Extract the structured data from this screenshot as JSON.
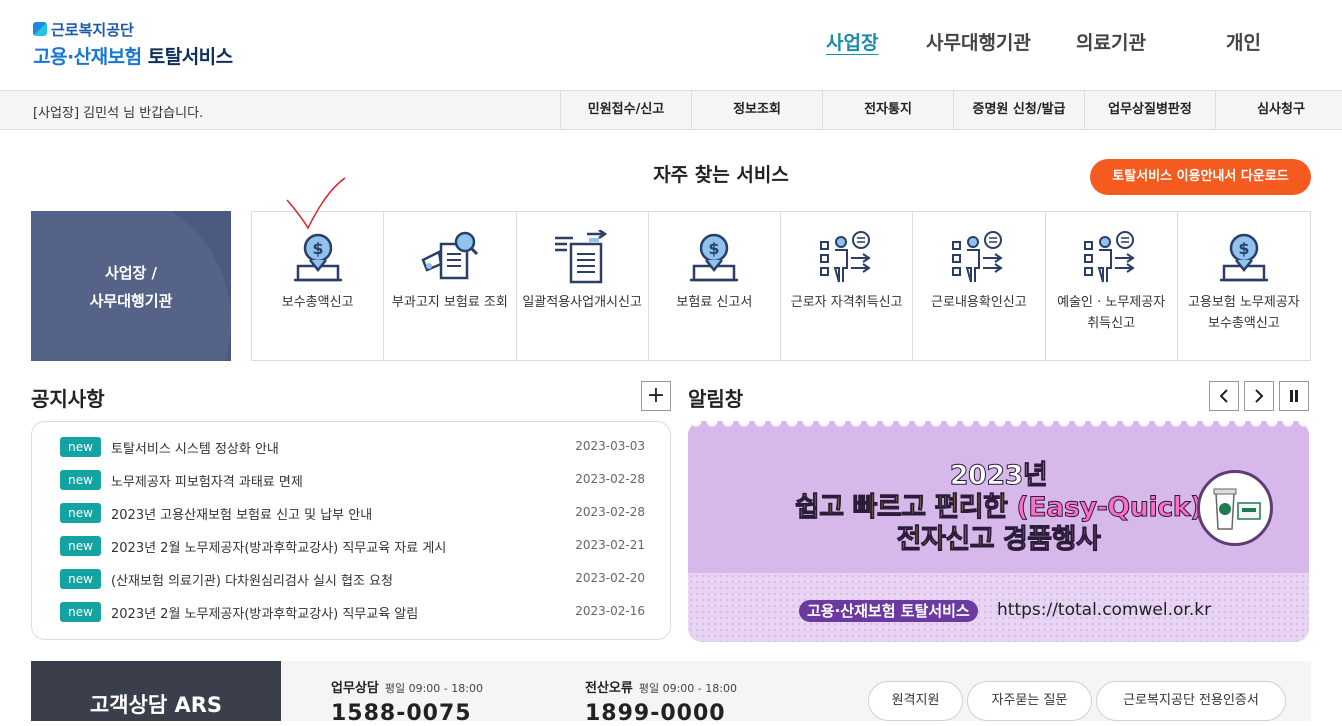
{
  "logo": {
    "org": "근로복지공단",
    "service_prefix": "고용·산재보험",
    "service_suffix": "토탈서비스"
  },
  "topnav": [
    "사업장",
    "사무대행기관",
    "의료기관",
    "개인"
  ],
  "subbar": {
    "welcome": "[사업장] 김민석 님 반갑습니다.",
    "menu": [
      "민원접수/신고",
      "정보조회",
      "전자통지",
      "증명원 신청/발급",
      "업무상질병판정",
      "심사청구"
    ]
  },
  "fav": {
    "title": "자주 찾는 서비스",
    "download_label": "토탈서비스 이용안내서 다운로드",
    "category": "사업장 / 사무대행기관",
    "items": [
      {
        "label": "보수총액신고",
        "icon": "money-laptop-icon"
      },
      {
        "label": "부과고지 보험료 조회",
        "icon": "document-search-icon"
      },
      {
        "label": "일괄적용사업개시신고",
        "icon": "documents-arrows-icon"
      },
      {
        "label": "보험료 신고서",
        "icon": "money-laptop-icon"
      },
      {
        "label": "근로자 자격취득신고",
        "icon": "person-checklist-icon"
      },
      {
        "label": "근로내용확인신고",
        "icon": "person-checklist-icon"
      },
      {
        "label": "예술인 · 노무제공자 취득신고",
        "icon": "person-checklist-icon"
      },
      {
        "label": "고용보험 노무제공자 보수총액신고",
        "icon": "money-laptop-icon"
      }
    ]
  },
  "notice": {
    "title": "공지사항",
    "more_label": "+",
    "items": [
      {
        "badge": "new",
        "title": "토탈서비스 시스템 정상화 안내",
        "date": "2023-03-03"
      },
      {
        "badge": "new",
        "title": "노무제공자 피보험자격 과태료 면제",
        "date": "2023-02-28"
      },
      {
        "badge": "new",
        "title": "2023년 고용산재보험 보험료 신고 및 납부 안내",
        "date": "2023-02-28"
      },
      {
        "badge": "new",
        "title": "2023년 2월 노무제공자(방과후학교강사) 직무교육 자료 게시",
        "date": "2023-02-21"
      },
      {
        "badge": "new",
        "title": "(산재보험 의료기관) 다차원심리검사 실시 협조 요청",
        "date": "2023-02-20"
      },
      {
        "badge": "new",
        "title": "2023년 2월 노무제공자(방과후학교강사) 직무교육 알림",
        "date": "2023-02-16"
      }
    ]
  },
  "alert": {
    "title": "알림창",
    "controls": [
      "chevron-left-icon",
      "chevron-right-icon",
      "pause-icon"
    ],
    "banner": {
      "line1": "2023년",
      "line2_a": "쉽고 빠르고 편리한 ",
      "line2_b": "(Easy-Quick)",
      "line3_a": "전자신고 ",
      "line3_b": "경품행사",
      "tag": "고용·산재보험 토탈서비스",
      "url": "https://total.comwel.or.kr"
    }
  },
  "footer": {
    "ars_title": "고객상담 ARS",
    "consult_label": "업무상담",
    "consult_hours": "평일 09:00 - 18:00",
    "consult_number": "1588-0075",
    "error_label": "전산오류",
    "error_hours": "평일 09:00 - 18:00",
    "error_number": "1899-0000",
    "buttons": [
      "원격지원",
      "자주묻는 질문",
      "근로복지공단 전용인증서"
    ]
  },
  "colors": {
    "accent": "#1a8ca8",
    "orange": "#f55b1f",
    "badge": "#13a3a3",
    "navy": "#4c5a82"
  }
}
